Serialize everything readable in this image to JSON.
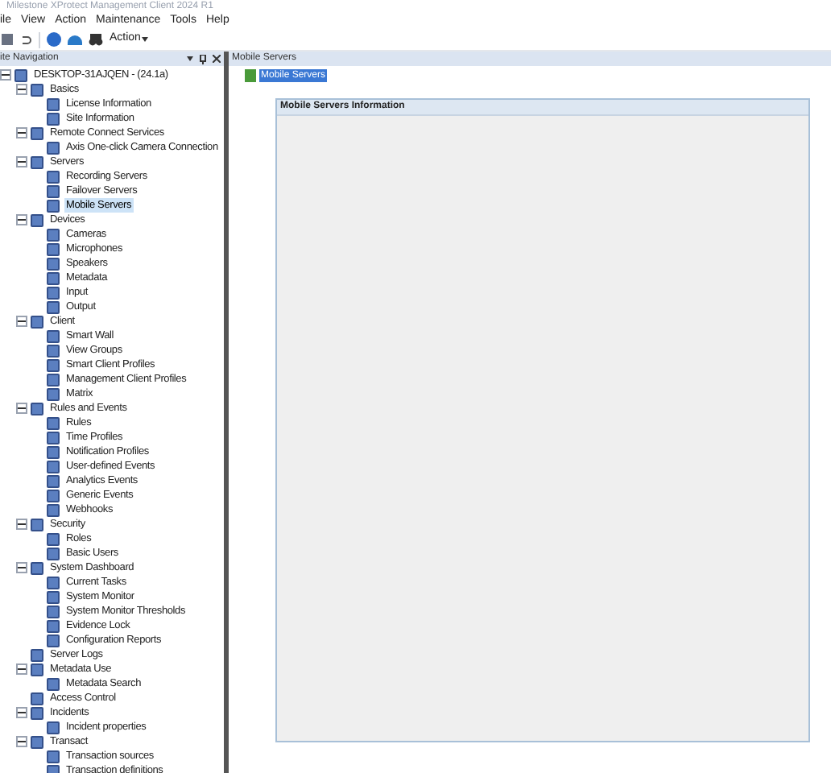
{
  "window": {
    "title": "Milestone XProtect Management Client 2024 R1"
  },
  "menu": [
    "ile",
    "View",
    "Action",
    "Maintenance",
    "Tools",
    "Help"
  ],
  "toolbar": {
    "action_label": "Action"
  },
  "navigation": {
    "title": "ite Navigation",
    "tree": {
      "label": "DESKTOP-31AJQEN - (24.1a)",
      "expanded": true,
      "selected": false,
      "children": [
        {
          "label": "Basics",
          "expanded": true,
          "selected": false,
          "children": [
            {
              "label": "License Information",
              "selected": false
            },
            {
              "label": "Site Information",
              "selected": false
            }
          ]
        },
        {
          "label": "Remote Connect Services",
          "expanded": true,
          "selected": false,
          "children": [
            {
              "label": "Axis One-click Camera Connection",
              "selected": false
            }
          ]
        },
        {
          "label": "Servers",
          "expanded": true,
          "selected": false,
          "children": [
            {
              "label": "Recording Servers",
              "selected": false
            },
            {
              "label": "Failover Servers",
              "selected": false
            },
            {
              "label": "Mobile Servers",
              "selected": true
            }
          ]
        },
        {
          "label": "Devices",
          "expanded": true,
          "selected": false,
          "children": [
            {
              "label": "Cameras",
              "selected": false
            },
            {
              "label": "Microphones",
              "selected": false
            },
            {
              "label": "Speakers",
              "selected": false
            },
            {
              "label": "Metadata",
              "selected": false
            },
            {
              "label": "Input",
              "selected": false
            },
            {
              "label": "Output",
              "selected": false
            }
          ]
        },
        {
          "label": "Client",
          "expanded": true,
          "selected": false,
          "children": [
            {
              "label": "Smart Wall",
              "selected": false
            },
            {
              "label": "View Groups",
              "selected": false
            },
            {
              "label": "Smart Client Profiles",
              "selected": false
            },
            {
              "label": "Management Client Profiles",
              "selected": false
            },
            {
              "label": "Matrix",
              "selected": false
            }
          ]
        },
        {
          "label": "Rules and Events",
          "expanded": true,
          "selected": false,
          "children": [
            {
              "label": "Rules",
              "selected": false
            },
            {
              "label": "Time Profiles",
              "selected": false
            },
            {
              "label": "Notification Profiles",
              "selected": false
            },
            {
              "label": "User-defined Events",
              "selected": false
            },
            {
              "label": "Analytics Events",
              "selected": false
            },
            {
              "label": "Generic Events",
              "selected": false
            },
            {
              "label": "Webhooks",
              "selected": false
            }
          ]
        },
        {
          "label": "Security",
          "expanded": true,
          "selected": false,
          "children": [
            {
              "label": "Roles",
              "selected": false
            },
            {
              "label": "Basic Users",
              "selected": false
            }
          ]
        },
        {
          "label": "System Dashboard",
          "expanded": true,
          "selected": false,
          "children": [
            {
              "label": "Current Tasks",
              "selected": false
            },
            {
              "label": "System Monitor",
              "selected": false
            },
            {
              "label": "System Monitor Thresholds",
              "selected": false
            },
            {
              "label": "Evidence Lock",
              "selected": false
            },
            {
              "label": "Configuration Reports",
              "selected": false
            }
          ]
        },
        {
          "label": "Server Logs",
          "selected": false
        },
        {
          "label": "Metadata Use",
          "expanded": true,
          "selected": false,
          "children": [
            {
              "label": "Metadata Search",
              "selected": false
            }
          ]
        },
        {
          "label": "Access Control",
          "selected": false
        },
        {
          "label": "Incidents",
          "expanded": true,
          "selected": false,
          "children": [
            {
              "label": "Incident properties",
              "selected": false
            }
          ]
        },
        {
          "label": "Transact",
          "expanded": true,
          "selected": false,
          "children": [
            {
              "label": "Transaction sources",
              "selected": false
            },
            {
              "label": "Transaction definitions",
              "selected": false
            }
          ]
        }
      ]
    }
  },
  "content": {
    "title": "Mobile Servers",
    "node": {
      "label": "Mobile Servers",
      "selected": true
    },
    "panel_title": "Mobile Servers Information"
  }
}
